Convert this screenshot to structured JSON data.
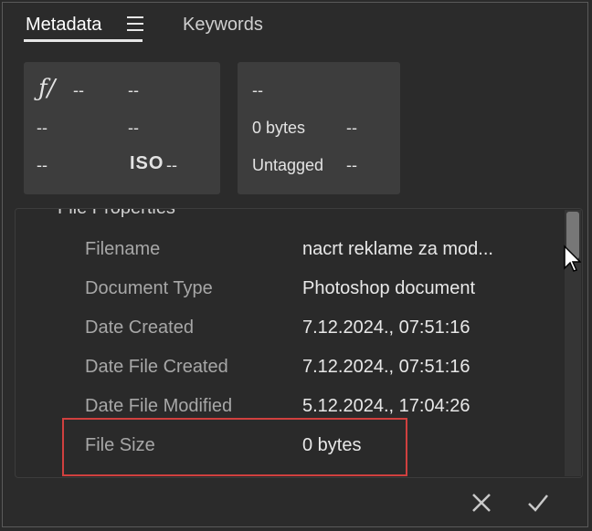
{
  "tabs": [
    {
      "label": "Metadata",
      "active": true
    },
    {
      "label": "Keywords",
      "active": false
    }
  ],
  "camera_info": {
    "aperture_symbol": "ƒ/",
    "aperture": "--",
    "shutter": "--",
    "row2_left": "--",
    "row2_right": "--",
    "row3_left": "--",
    "iso_label": "ISO",
    "iso_value": "--"
  },
  "file_info": {
    "dimensions": "--",
    "size": "0 bytes",
    "size_extra": "--",
    "color_profile": "Untagged",
    "color_extra": "--"
  },
  "file_properties": {
    "section_title": "File Properties",
    "rows": [
      {
        "label": "Filename",
        "value": "nacrt reklame za mod..."
      },
      {
        "label": "Document Type",
        "value": "Photoshop document"
      },
      {
        "label": "Date Created",
        "value": "7.12.2024., 07:51:16"
      },
      {
        "label": "Date File Created",
        "value": "7.12.2024., 07:51:16"
      },
      {
        "label": "Date File Modified",
        "value": "5.12.2024., 17:04:26"
      },
      {
        "label": "File Size",
        "value": "0 bytes"
      }
    ]
  },
  "footer": {
    "cancel_icon": "close-icon",
    "confirm_icon": "checkmark-icon"
  },
  "colors": {
    "highlight": "#d0403f",
    "background": "#2b2b2b",
    "panel": "#3d3d3d"
  }
}
